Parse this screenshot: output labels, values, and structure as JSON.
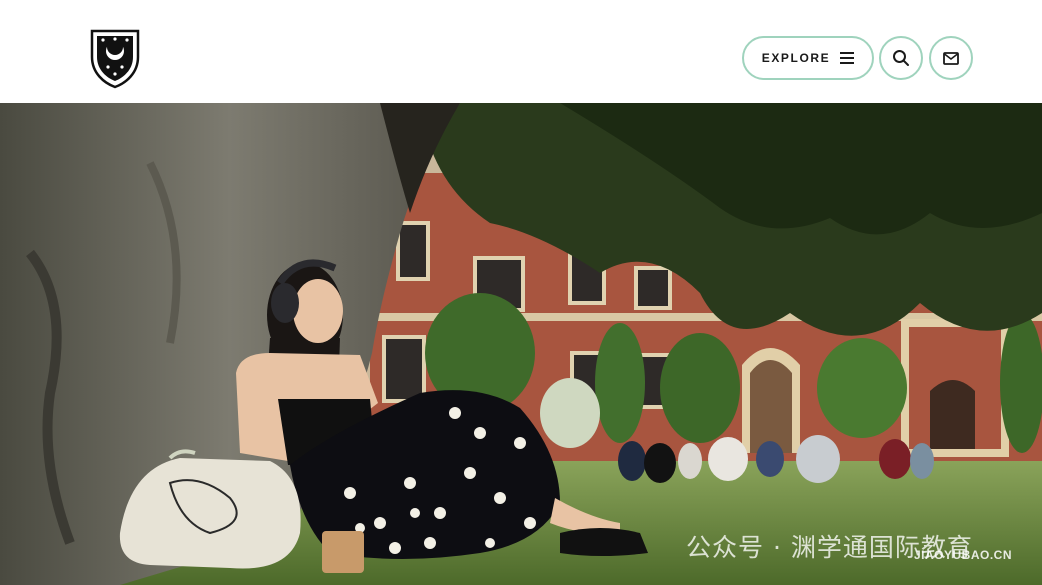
{
  "header": {
    "logo_name": "college-crest",
    "explore_label": "EXPLORE",
    "explore_icon": "menu-hamburger-icon",
    "search_icon": "search-icon",
    "mail_icon": "mail-icon"
  },
  "colors": {
    "button_border": "#9fd3bd",
    "header_bg": "#ffffff",
    "text_dark": "#1a1a1a"
  },
  "hero": {
    "image_name": "student-reading-under-tree-photo"
  },
  "watermark": {
    "text": "公众号 · 渊学通国际教育",
    "site": "JIAOYUBAO.CN"
  }
}
